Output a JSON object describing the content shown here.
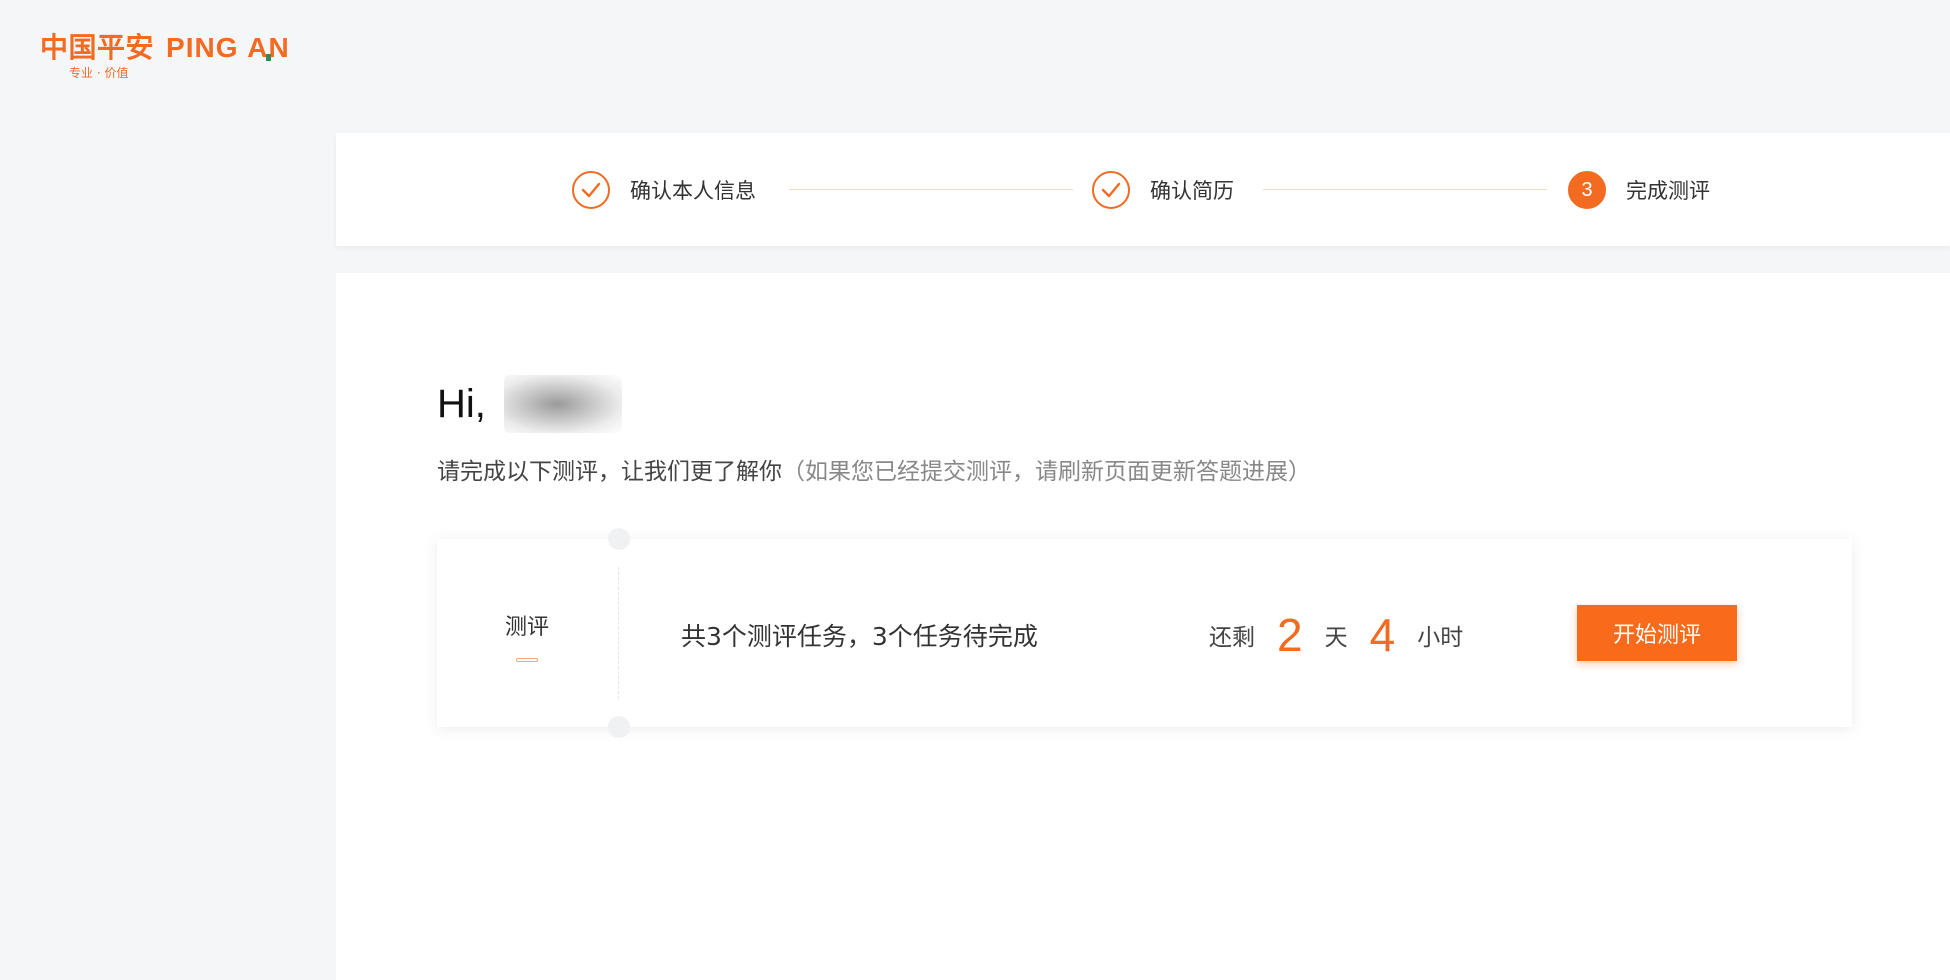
{
  "logo": {
    "cn": "中国平安",
    "en_part1": "PING",
    "en_part2": "AN",
    "tagline": "专业 · 价值"
  },
  "steps": [
    {
      "label": "确认本人信息",
      "status": "done",
      "icon": "check-icon"
    },
    {
      "label": "确认简历",
      "status": "done",
      "icon": "check-icon"
    },
    {
      "label": "完成测评",
      "status": "active",
      "number": "3"
    }
  ],
  "greeting": {
    "hi": "Hi,"
  },
  "subtitle": {
    "main": "请完成以下测评，让我们更了解你",
    "note": "（如果您已经提交测评，请刷新页面更新答题进展）"
  },
  "assessment": {
    "label": "测评",
    "summary": "共3个测评任务，3个任务待完成",
    "remaining_label": "还剩",
    "days": "2",
    "days_unit": "天",
    "hours": "4",
    "hours_unit": "小时",
    "start_button": "开始测评"
  },
  "colors": {
    "accent": "#f26b21",
    "button": "#f96a1b",
    "background": "#f5f6f8"
  }
}
